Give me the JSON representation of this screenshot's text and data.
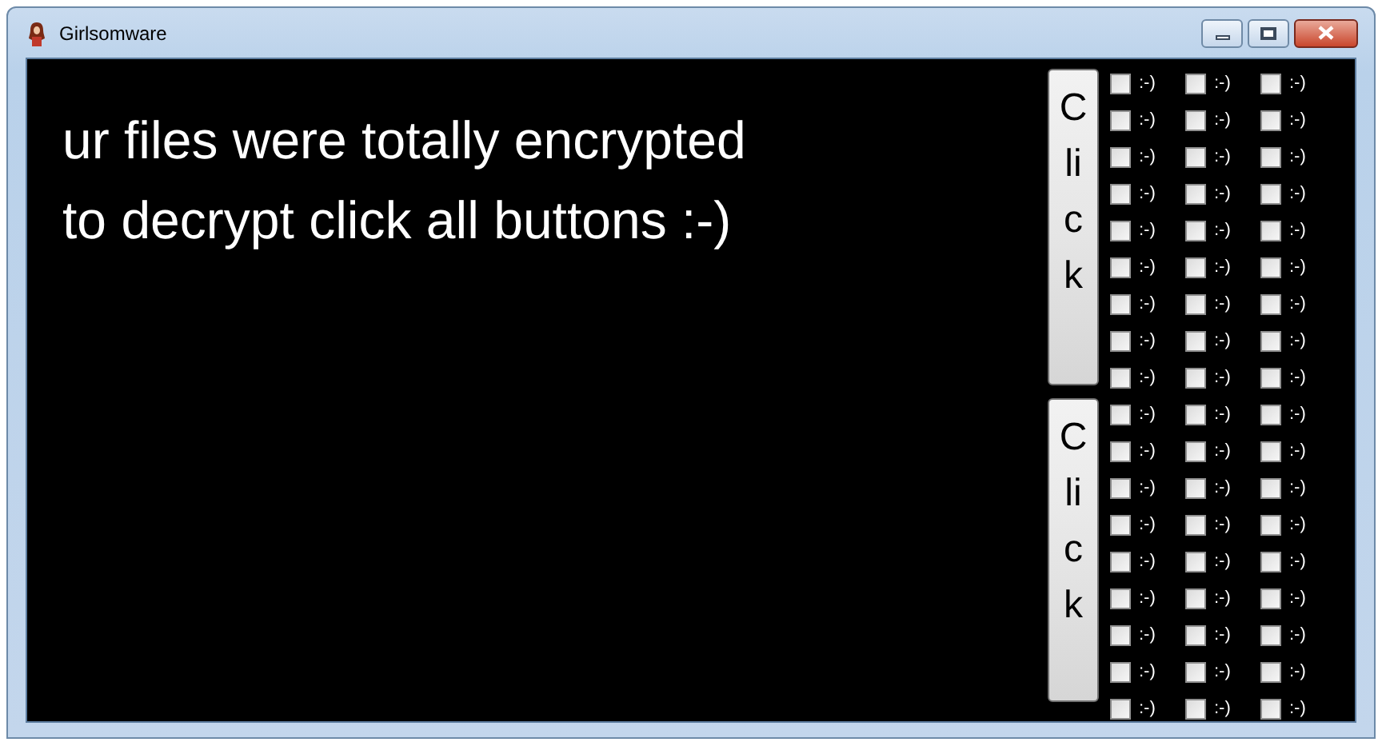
{
  "window": {
    "title": "Girlsomware"
  },
  "message_lines": [
    "ur files were totally encrypted",
    "to decrypt click all buttons :-)"
  ],
  "click_buttons": [
    {
      "label": "Click"
    },
    {
      "label": "Click"
    }
  ],
  "checkboxes": [
    {
      "label": ":-)",
      "checked": false
    },
    {
      "label": ":-)",
      "checked": false
    },
    {
      "label": ":-)",
      "checked": false
    },
    {
      "label": ":-)",
      "checked": false
    },
    {
      "label": ":-)",
      "checked": false
    },
    {
      "label": ":-)",
      "checked": false
    },
    {
      "label": ":-)",
      "checked": false
    },
    {
      "label": ":-)",
      "checked": false
    },
    {
      "label": ":-)",
      "checked": false
    },
    {
      "label": ":-)",
      "checked": false
    },
    {
      "label": ":-)",
      "checked": false
    },
    {
      "label": ":-)",
      "checked": false
    },
    {
      "label": ":-)",
      "checked": false
    },
    {
      "label": ":-)",
      "checked": false
    },
    {
      "label": ":-)",
      "checked": false
    },
    {
      "label": ":-)",
      "checked": false
    },
    {
      "label": ":-)",
      "checked": false
    },
    {
      "label": ":-)",
      "checked": false
    },
    {
      "label": ":-)",
      "checked": false
    },
    {
      "label": ":-)",
      "checked": false
    },
    {
      "label": ":-)",
      "checked": false
    },
    {
      "label": ":-)",
      "checked": false
    },
    {
      "label": ":-)",
      "checked": false
    },
    {
      "label": ":-)",
      "checked": false
    },
    {
      "label": ":-)",
      "checked": false
    },
    {
      "label": ":-)",
      "checked": false
    },
    {
      "label": ":-)",
      "checked": false
    },
    {
      "label": ":-)",
      "checked": false
    },
    {
      "label": ":-)",
      "checked": false
    },
    {
      "label": ":-)",
      "checked": false
    },
    {
      "label": ":-)",
      "checked": false
    },
    {
      "label": ":-)",
      "checked": false
    },
    {
      "label": ":-)",
      "checked": false
    },
    {
      "label": ":-)",
      "checked": false
    },
    {
      "label": ":-)",
      "checked": false
    },
    {
      "label": ":-)",
      "checked": false
    },
    {
      "label": ":-)",
      "checked": false
    },
    {
      "label": ":-)",
      "checked": false
    },
    {
      "label": ":-)",
      "checked": false
    },
    {
      "label": ":-)",
      "checked": false
    },
    {
      "label": ":-)",
      "checked": false
    },
    {
      "label": ":-)",
      "checked": false
    },
    {
      "label": ":-)",
      "checked": false
    },
    {
      "label": ":-)",
      "checked": false
    },
    {
      "label": ":-)",
      "checked": false
    },
    {
      "label": ":-)",
      "checked": false
    },
    {
      "label": ":-)",
      "checked": false
    },
    {
      "label": ":-)",
      "checked": false
    },
    {
      "label": ":-)",
      "checked": false
    },
    {
      "label": ":-)",
      "checked": false
    },
    {
      "label": ":-)",
      "checked": false
    },
    {
      "label": ":-)",
      "checked": false
    },
    {
      "label": ":-)",
      "checked": false
    },
    {
      "label": ":-)",
      "checked": false
    }
  ]
}
